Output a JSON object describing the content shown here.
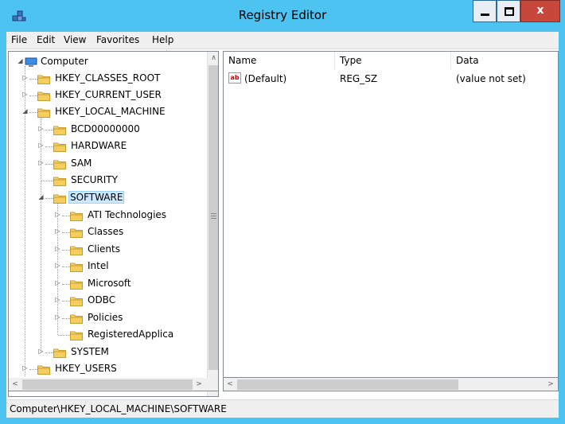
{
  "window": {
    "title": "Registry Editor",
    "accent_color": "#4cc3f0",
    "close_color": "#c7473a",
    "close_label": "x"
  },
  "menu": [
    "File",
    "Edit",
    "View",
    "Favorites",
    "Help"
  ],
  "tree": {
    "root": "Computer",
    "hives": [
      "HKEY_CLASSES_ROOT",
      "HKEY_CURRENT_USER",
      "HKEY_LOCAL_MACHINE",
      "HKEY_USERS"
    ],
    "hklm_children": [
      "BCD00000000",
      "HARDWARE",
      "SAM",
      "SECURITY",
      "SOFTWARE",
      "SYSTEM"
    ],
    "software_children": [
      "ATI Technologies",
      "Classes",
      "Clients",
      "Intel",
      "Microsoft",
      "ODBC",
      "Policies",
      "RegisteredApplica"
    ],
    "selected": "SOFTWARE",
    "selection_color": "#cce8ff"
  },
  "list": {
    "columns": [
      "Name",
      "Type",
      "Data"
    ],
    "rows": [
      {
        "name": "(Default)",
        "type": "REG_SZ",
        "data": "(value not set)",
        "icon": "string-value-icon"
      }
    ]
  },
  "status": {
    "path": "Computer\\HKEY_LOCAL_MACHINE\\SOFTWARE"
  }
}
